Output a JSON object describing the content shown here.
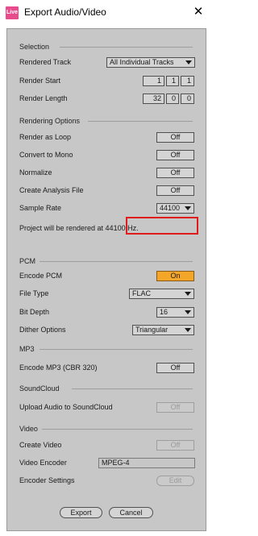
{
  "window": {
    "title": "Export Audio/Video",
    "app_icon_text": "Live",
    "close_glyph": "✕"
  },
  "selection": {
    "header": "Selection",
    "rendered_track": {
      "label": "Rendered Track",
      "value": "All Individual Tracks"
    },
    "render_start": {
      "label": "Render Start",
      "bar": "1",
      "beat": "1",
      "sixteenth": "1"
    },
    "render_length": {
      "label": "Render Length",
      "bar": "32",
      "beat": "0",
      "sixteenth": "0"
    }
  },
  "rendering_options": {
    "header": "Rendering Options",
    "render_as_loop": {
      "label": "Render as Loop",
      "value": "Off"
    },
    "convert_to_mono": {
      "label": "Convert to Mono",
      "value": "Off"
    },
    "normalize": {
      "label": "Normalize",
      "value": "Off"
    },
    "create_analysis_file": {
      "label": "Create Analysis File",
      "value": "Off"
    },
    "sample_rate": {
      "label": "Sample Rate",
      "value": "44100"
    },
    "info": "Project will be rendered at 44100 Hz."
  },
  "pcm": {
    "header": "PCM",
    "encode_pcm": {
      "label": "Encode PCM",
      "value": "On"
    },
    "file_type": {
      "label": "File Type",
      "value": "FLAC"
    },
    "bit_depth": {
      "label": "Bit Depth",
      "value": "16"
    },
    "dither_options": {
      "label": "Dither Options",
      "value": "Triangular"
    }
  },
  "mp3": {
    "header": "MP3",
    "encode_mp3": {
      "label": "Encode MP3 (CBR 320)",
      "value": "Off"
    }
  },
  "soundcloud": {
    "header": "SoundCloud",
    "upload": {
      "label": "Upload Audio to SoundCloud",
      "value": "Off"
    }
  },
  "video": {
    "header": "Video",
    "create_video": {
      "label": "Create Video",
      "value": "Off"
    },
    "video_encoder": {
      "label": "Video Encoder",
      "value": "MPEG-4"
    },
    "encoder_settings": {
      "label": "Encoder Settings",
      "value": "Edit"
    }
  },
  "footer": {
    "export_label": "Export",
    "cancel_label": "Cancel"
  },
  "colors": {
    "accent_on": "#f3a628",
    "highlight": "#e01b1b",
    "panel": "#c7c7c7"
  }
}
